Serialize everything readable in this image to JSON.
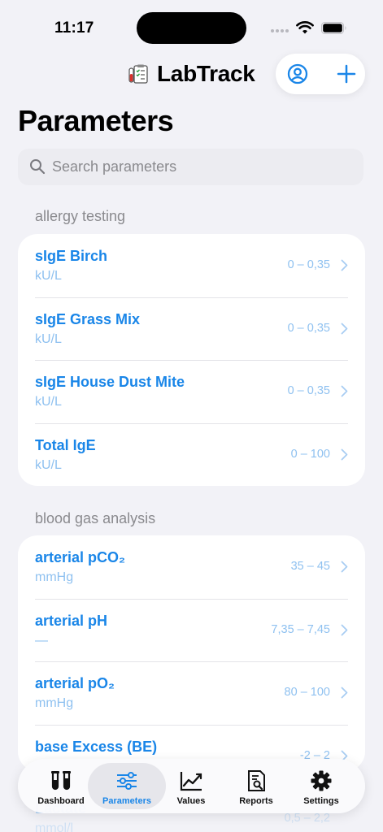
{
  "status_bar": {
    "time": "11:17"
  },
  "header": {
    "app_title": "LabTrack"
  },
  "page": {
    "title": "Parameters"
  },
  "search": {
    "placeholder": "Search parameters"
  },
  "sections": [
    {
      "title": "allergy testing",
      "items": [
        {
          "name": "sIgE Birch",
          "unit": "kU/L",
          "range": "0 – 0,35"
        },
        {
          "name": "sIgE Grass Mix",
          "unit": "kU/L",
          "range": "0 – 0,35"
        },
        {
          "name": "sIgE House Dust Mite",
          "unit": "kU/L",
          "range": "0 – 0,35"
        },
        {
          "name": "Total IgE",
          "unit": "kU/L",
          "range": "0 – 100"
        }
      ]
    },
    {
      "title": "blood gas analysis",
      "items": [
        {
          "name": "arterial pCO₂",
          "unit": "mmHg",
          "range": "35 – 45"
        },
        {
          "name": "arterial pH",
          "unit": "—",
          "range": "7,35 – 7,45"
        },
        {
          "name": "arterial pO₂",
          "unit": "mmHg",
          "range": "80 – 100"
        },
        {
          "name": "base Excess (BE)",
          "unit": "",
          "range": "-2 – 2"
        }
      ]
    }
  ],
  "ghost_row": {
    "name": "Lactate",
    "unit": "mmol/l",
    "range": "0,5 – 2,2"
  },
  "tabs": [
    {
      "label": "Dashboard",
      "icon": "test-tubes-icon",
      "active": false
    },
    {
      "label": "Parameters",
      "icon": "sliders-icon",
      "active": true
    },
    {
      "label": "Values",
      "icon": "line-chart-icon",
      "active": false
    },
    {
      "label": "Reports",
      "icon": "document-search-icon",
      "active": false
    },
    {
      "label": "Settings",
      "icon": "gear-icon",
      "active": false
    }
  ],
  "colors": {
    "accent": "#1a86e8",
    "accent_light": "#8fc1f0",
    "background": "#f2f2f7"
  }
}
